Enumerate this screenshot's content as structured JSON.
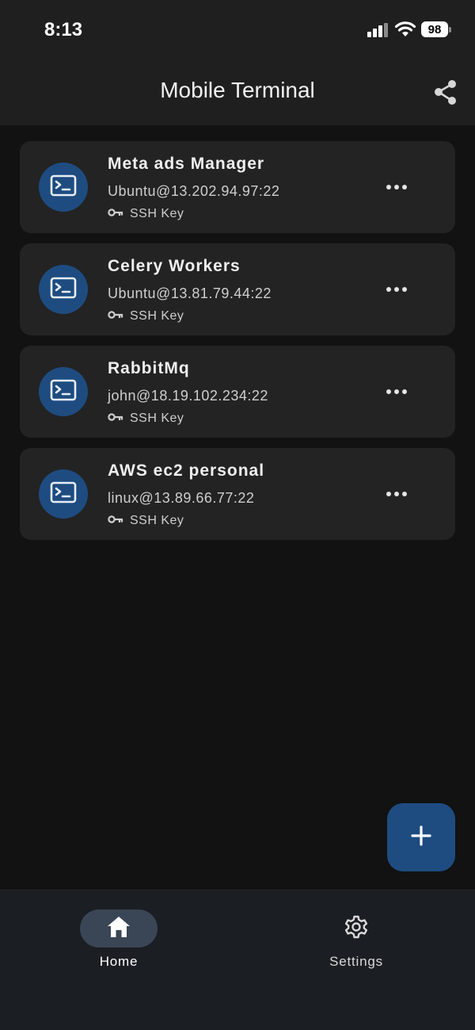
{
  "status_bar": {
    "time": "8:13",
    "battery": "98"
  },
  "app_bar": {
    "title": "Mobile Terminal",
    "share_icon": "share-icon"
  },
  "connections": [
    {
      "name": "Meta ads Manager",
      "host": "Ubuntu@13.202.94.97:22",
      "auth": "SSH Key"
    },
    {
      "name": "Celery Workers",
      "host": "Ubuntu@13.81.79.44:22",
      "auth": "SSH Key"
    },
    {
      "name": "RabbitMq",
      "host": "john@18.19.102.234:22",
      "auth": "SSH Key"
    },
    {
      "name": "AWS ec2 personal",
      "host": "linux@13.89.66.77:22",
      "auth": "SSH Key"
    }
  ],
  "fab": {
    "icon": "plus-icon"
  },
  "bottom_nav": {
    "items": [
      {
        "label": "Home",
        "icon": "home-icon",
        "active": true
      },
      {
        "label": "Settings",
        "icon": "gear-icon",
        "active": false
      }
    ]
  },
  "colors": {
    "background": "#121212",
    "bar": "#1f1f1f",
    "card": "#232323",
    "accent": "#1e4c80",
    "nav_active": "#3a4556"
  }
}
